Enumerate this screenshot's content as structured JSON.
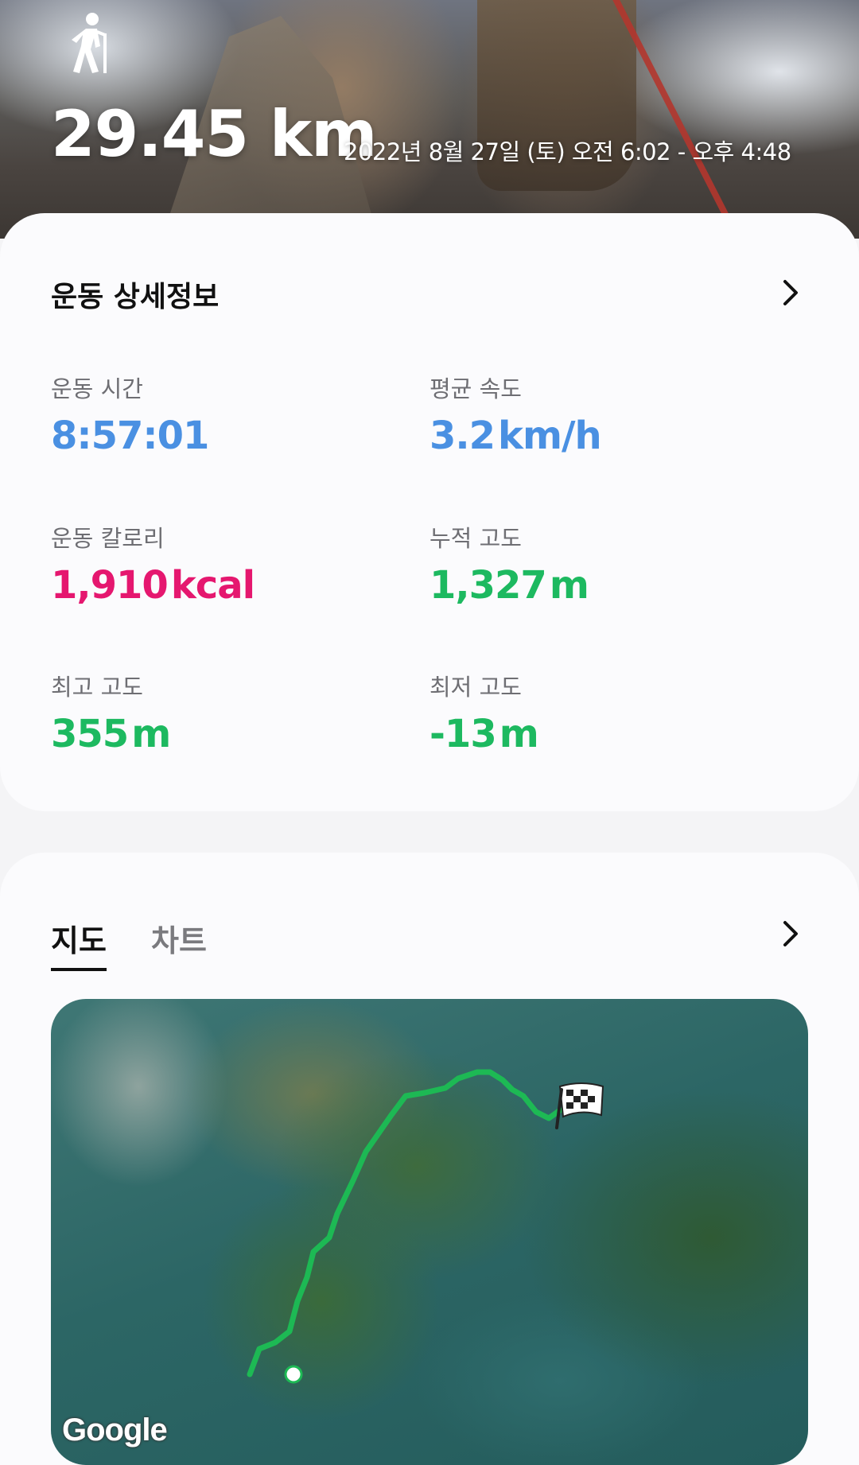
{
  "header": {
    "icon": "hiker-icon",
    "distance": "29.45 km",
    "date_range": "2022년 8월 27일 (토) 오전 6:02 - 오후 4:48"
  },
  "details": {
    "title": "운동 상세정보",
    "stats": [
      {
        "label": "운동 시간",
        "value": "8:57:01",
        "unit": "",
        "color": "#4a90e2"
      },
      {
        "label": "평균 속도",
        "value": "3.2",
        "unit": "km/h",
        "color": "#4a90e2"
      },
      {
        "label": "운동 칼로리",
        "value": "1,910",
        "unit": "kcal",
        "color": "#e5176f"
      },
      {
        "label": "누적 고도",
        "value": "1,327",
        "unit": "m",
        "color": "#1db960"
      },
      {
        "label": "최고 고도",
        "value": "355",
        "unit": "m",
        "color": "#1db960"
      },
      {
        "label": "최저 고도",
        "value": "-13",
        "unit": "m",
        "color": "#1db960"
      }
    ]
  },
  "map_section": {
    "tabs": [
      {
        "label": "지도",
        "active": true
      },
      {
        "label": "차트",
        "active": false
      }
    ],
    "attribution": "Google",
    "route_color": "#1db954",
    "markers": [
      "start-dot",
      "finish-flag-icon"
    ]
  }
}
